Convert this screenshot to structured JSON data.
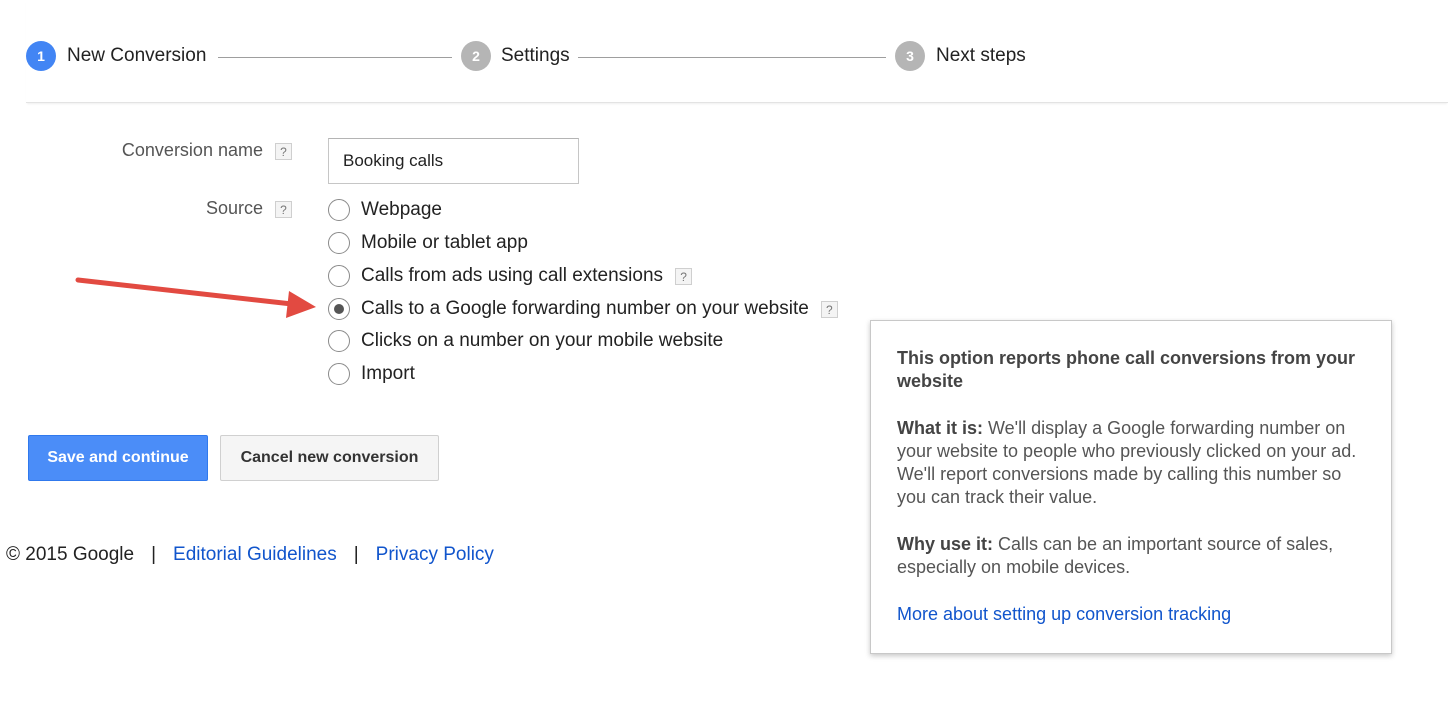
{
  "stepper": {
    "steps": [
      {
        "number": "1",
        "label": "New Conversion",
        "state": "active"
      },
      {
        "number": "2",
        "label": "Settings",
        "state": "inactive"
      },
      {
        "number": "3",
        "label": "Next steps",
        "state": "inactive"
      }
    ]
  },
  "form": {
    "conversion_name": {
      "label": "Conversion name",
      "help": "?",
      "value": "Booking calls"
    },
    "source": {
      "label": "Source",
      "help": "?",
      "options": [
        {
          "label": "Webpage",
          "selected": false
        },
        {
          "label": "Mobile or tablet app",
          "selected": false
        },
        {
          "label": "Calls from ads using call extensions",
          "selected": false,
          "help": "?"
        },
        {
          "label": "Calls to a Google forwarding number on your website",
          "selected": true,
          "help": "?"
        },
        {
          "label": "Clicks on a number on your mobile website",
          "selected": false
        },
        {
          "label": "Import",
          "selected": false
        }
      ]
    }
  },
  "buttons": {
    "save": "Save and continue",
    "cancel": "Cancel new conversion"
  },
  "footer": {
    "copyright": "© 2015 Google",
    "separator": "|",
    "links": [
      "Editorial Guidelines",
      "Privacy Policy"
    ]
  },
  "tooltip": {
    "title": "This option reports phone call conversions from your website",
    "what_label": "What it is:",
    "what_text": " We'll display a Google forwarding number on your website to people who previously clicked on your ad. We'll report conversions made by calling this number so you can track their value.",
    "why_label": "Why use it:",
    "why_text": " Calls can be an important source of sales, especially on mobile devices.",
    "link": "More about setting up conversion tracking"
  },
  "colors": {
    "accent_blue": "#4285f4",
    "link_blue": "#1155cc",
    "primary_button": "#4b8df8",
    "annotation_arrow": "#e24a41"
  }
}
